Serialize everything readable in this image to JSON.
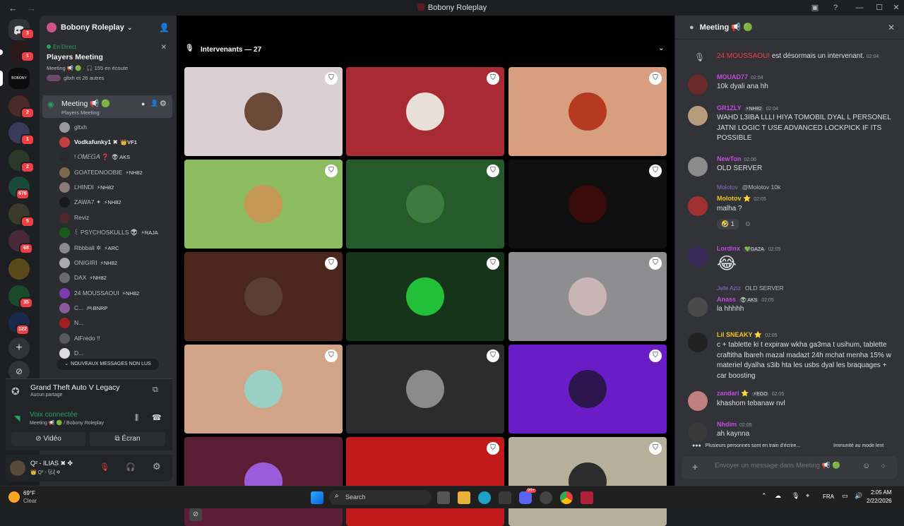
{
  "window": {
    "title": "Bobony Roleplay"
  },
  "server": {
    "name": "Bobony Roleplay"
  },
  "rail_badges": [
    "3",
    "1",
    "2",
    "1",
    "2",
    "676",
    "5",
    "68",
    "35",
    "122"
  ],
  "live": {
    "status": "En Direct",
    "title": "Players Meeting",
    "info": "Meeting 📢 🟢 · 🎧 155 en écoute",
    "participants": "gltxh et 26 autres"
  },
  "voice_channel": {
    "name": "Meeting 📢 🟢",
    "subtitle": "Players Meeting"
  },
  "members": [
    {
      "name": "gltxh",
      "tag": ""
    },
    {
      "name": "Vodkafunky1 ✖",
      "tag": "👑VF1"
    },
    {
      "name": "! 𝑂𝑀𝐸𝐺𝐴 ❓",
      "tag": "👽 AKS"
    },
    {
      "name": "GOATEDNOOBIE",
      "tag": "⚡NH82"
    },
    {
      "name": "LHINDI",
      "tag": "⚡NH82"
    },
    {
      "name": "ZAWA7 ✦",
      "tag": "⚡NH82"
    },
    {
      "name": "Reviz",
      "tag": ""
    },
    {
      "name": "꒰ PSYCHOSKULLS 👽",
      "tag": "⚡RAJA"
    },
    {
      "name": "Rbbball ✲",
      "tag": "⚡ARC"
    },
    {
      "name": "ONIGIRI",
      "tag": "⚡NH82"
    },
    {
      "name": "DAX",
      "tag": "⚡NH82"
    },
    {
      "name": "24 MOUSSAOUI",
      "tag": "⚡NH82"
    },
    {
      "name": "C...",
      "tag": "🎮BNRP"
    },
    {
      "name": "N...",
      "tag": ""
    },
    {
      "name": "AlFredo !!",
      "tag": ""
    },
    {
      "name": "D...",
      "tag": ""
    }
  ],
  "new_messages": "NOUVEAUX MESSAGES NON LUS",
  "activity": {
    "game": "Grand Theft Auto V Legacy",
    "sub": "Aucun partage"
  },
  "voice": {
    "status": "Voix connectée",
    "detail": "Meeting 📢 🟢 / Bobony Roleplay",
    "video": "Vidéo",
    "screen": "Écran"
  },
  "user": {
    "name": "Q² - ILIAS ✖ ✤",
    "sub": "👑 Q² - 덩₰ ✲"
  },
  "stage": {
    "header": "Intervenants — 27"
  },
  "tiles": [
    {
      "bg": "#dad0d3",
      "av": "#6b4a3a",
      "mod": true
    },
    {
      "bg": "#a82a33",
      "av": "#e8e0d8",
      "mod": true
    },
    {
      "bg": "#d79f7f",
      "av": "#b53a20",
      "mod": true
    },
    {
      "bg": "#8dbb5f",
      "av": "#c69855",
      "mod": true
    },
    {
      "bg": "#265a2c",
      "av": "#3c7a40",
      "mod": true
    },
    {
      "bg": "#0f0f10",
      "av": "#3a0b0b",
      "mod": true
    },
    {
      "bg": "#4b261d",
      "av": "#5a4030",
      "mod": true
    },
    {
      "bg": "#16341a",
      "av": "#22c038",
      "mod": true
    },
    {
      "bg": "#8e8d8f",
      "av": "#c9b5b5",
      "mod": true
    },
    {
      "bg": "#d1a48a",
      "av": "#9acfc5",
      "mod": true
    },
    {
      "bg": "#2c2c2c",
      "av": "#8a8a8a",
      "mod": true
    },
    {
      "bg": "#6a1cc8",
      "av": "#2d1650",
      "mod": true
    },
    {
      "bg": "#5c1e35",
      "av": "#9a5cd8",
      "mod": false
    },
    {
      "bg": "#c21a1a",
      "av": "#c21a1a",
      "mod": true
    },
    {
      "bg": "#b6b09a",
      "av": "#2d2d2d",
      "mod": true
    }
  ],
  "chat": {
    "channel": "Meeting 📢 🟢",
    "system": {
      "name": "24 MOUSSAOUI",
      "text": "est désormais un intervenant.",
      "time": "02:04"
    },
    "messages": [
      {
        "name": "MOUAD77",
        "color": "#c44ce0",
        "time": "02:04",
        "text": "10k dyali ana hh",
        "av": "#6b2a2a"
      },
      {
        "name": "GR1ZLY",
        "color": "#c44ce0",
        "tag": "⚡NH82",
        "time": "02:04",
        "text": "WAHD L3IBA LLLI HIYA TOMOBIL DYAL L PERSONEL JATNI LOGIC T USE ADVANCED LOCKPICK IF ITS POSSIBLE",
        "av": "#b59c7c"
      },
      {
        "name": "NewTon",
        "color": "#c44ce0",
        "time": "02:06",
        "text": "OLD SERVER",
        "av": "#8a8a8a"
      },
      {
        "reply_name": "Molotov",
        "reply_text": "@Molotov 10k",
        "name": "Molotov ⭐",
        "color": "#f0c419",
        "time": "02:05",
        "text": "malha ?",
        "reaction": "🤣 1",
        "av": "#a03030"
      },
      {
        "name": "Lordinx",
        "color": "#c44ce0",
        "tag": "💚GAZA",
        "time": "02:05",
        "text": "😂",
        "av": "#3a2a5a"
      },
      {
        "reply_name": "Jefe Aziz",
        "reply_text": "OLD SERVER",
        "name": "Anass",
        "color": "#c44ce0",
        "tag": "👽 AKS",
        "time": "02:05",
        "text": "la hhhhh",
        "av": "#4a4a4a"
      },
      {
        "name": "Lil SNEAKY ⭐",
        "color": "#f0c419",
        "time": "02:05",
        "text": "c + tablette ki t expiraw wkha ga3ma t usihum, tablette craftitha lbareh mazal madazt 24h mchat menha 15% w materiel dyalha s3ib hta les usbs dyal les braquages + car boosting",
        "av": "#222222"
      },
      {
        "name": "zandari ⭐",
        "color": "#c44ce0",
        "tag": "⚡EGO",
        "time": "02:05",
        "text": "khashom tebanaw nvl",
        "av": "#c08080"
      },
      {
        "name": "Nhdim",
        "color": "#c44ce0",
        "time": "02:05",
        "text": "ah  kaynna",
        "av": "#3a3a3a"
      }
    ],
    "typing": "Plusieurs personnes sont en train d'écrire...",
    "slowmode": "Immunité au mode lent",
    "input_placeholder": "Envoyer un message dans Meeting 📢 🟢"
  },
  "taskbar": {
    "weather_temp": "69°F",
    "weather_desc": "Clear",
    "search_placeholder": "Search",
    "lang": "FRA",
    "time": "2:05 AM",
    "date": "2/22/2026",
    "discord_badge": "99+"
  }
}
